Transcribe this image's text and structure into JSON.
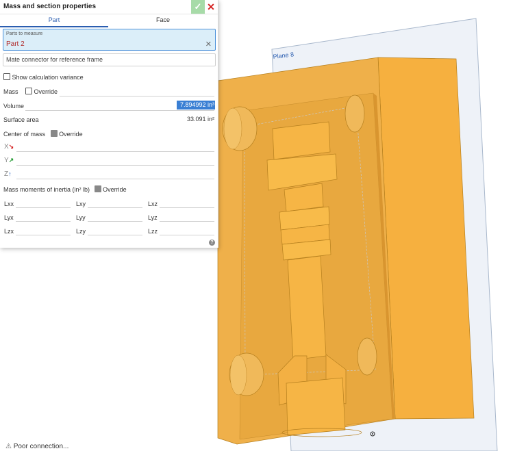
{
  "dialog": {
    "title": "Mass and section properties",
    "tabs": [
      "Part",
      "Face"
    ],
    "parts_label": "Parts to measure",
    "part_value": "Part 2",
    "mate_placeholder": "Mate connector for reference frame",
    "show_variance_label": "Show calculation variance",
    "mass_label": "Mass",
    "override_label": "Override",
    "volume_label": "Volume",
    "volume_value": "7.894992 in³",
    "surface_area_label": "Surface area",
    "surface_area_value": "33.091 in²",
    "com_label": "Center of mass",
    "axes": [
      {
        "label": "X",
        "arrow": "↘",
        "color": "#d42020"
      },
      {
        "label": "Y",
        "arrow": "↗",
        "color": "#1e9a2e"
      },
      {
        "label": "Z",
        "arrow": "↑",
        "color": "#1f5fc0"
      }
    ],
    "moi_label": "Mass moments of inertia (in² lb)",
    "moi_cells": [
      "Lxx",
      "Lxy",
      "Lxz",
      "Lyx",
      "Lyy",
      "Lyz",
      "Lzx",
      "Lzy",
      "Lzz"
    ]
  },
  "viewport": {
    "plane_label": "Plane 8",
    "part_color": "#f5b74a"
  },
  "status": {
    "text": "Poor connection..."
  }
}
